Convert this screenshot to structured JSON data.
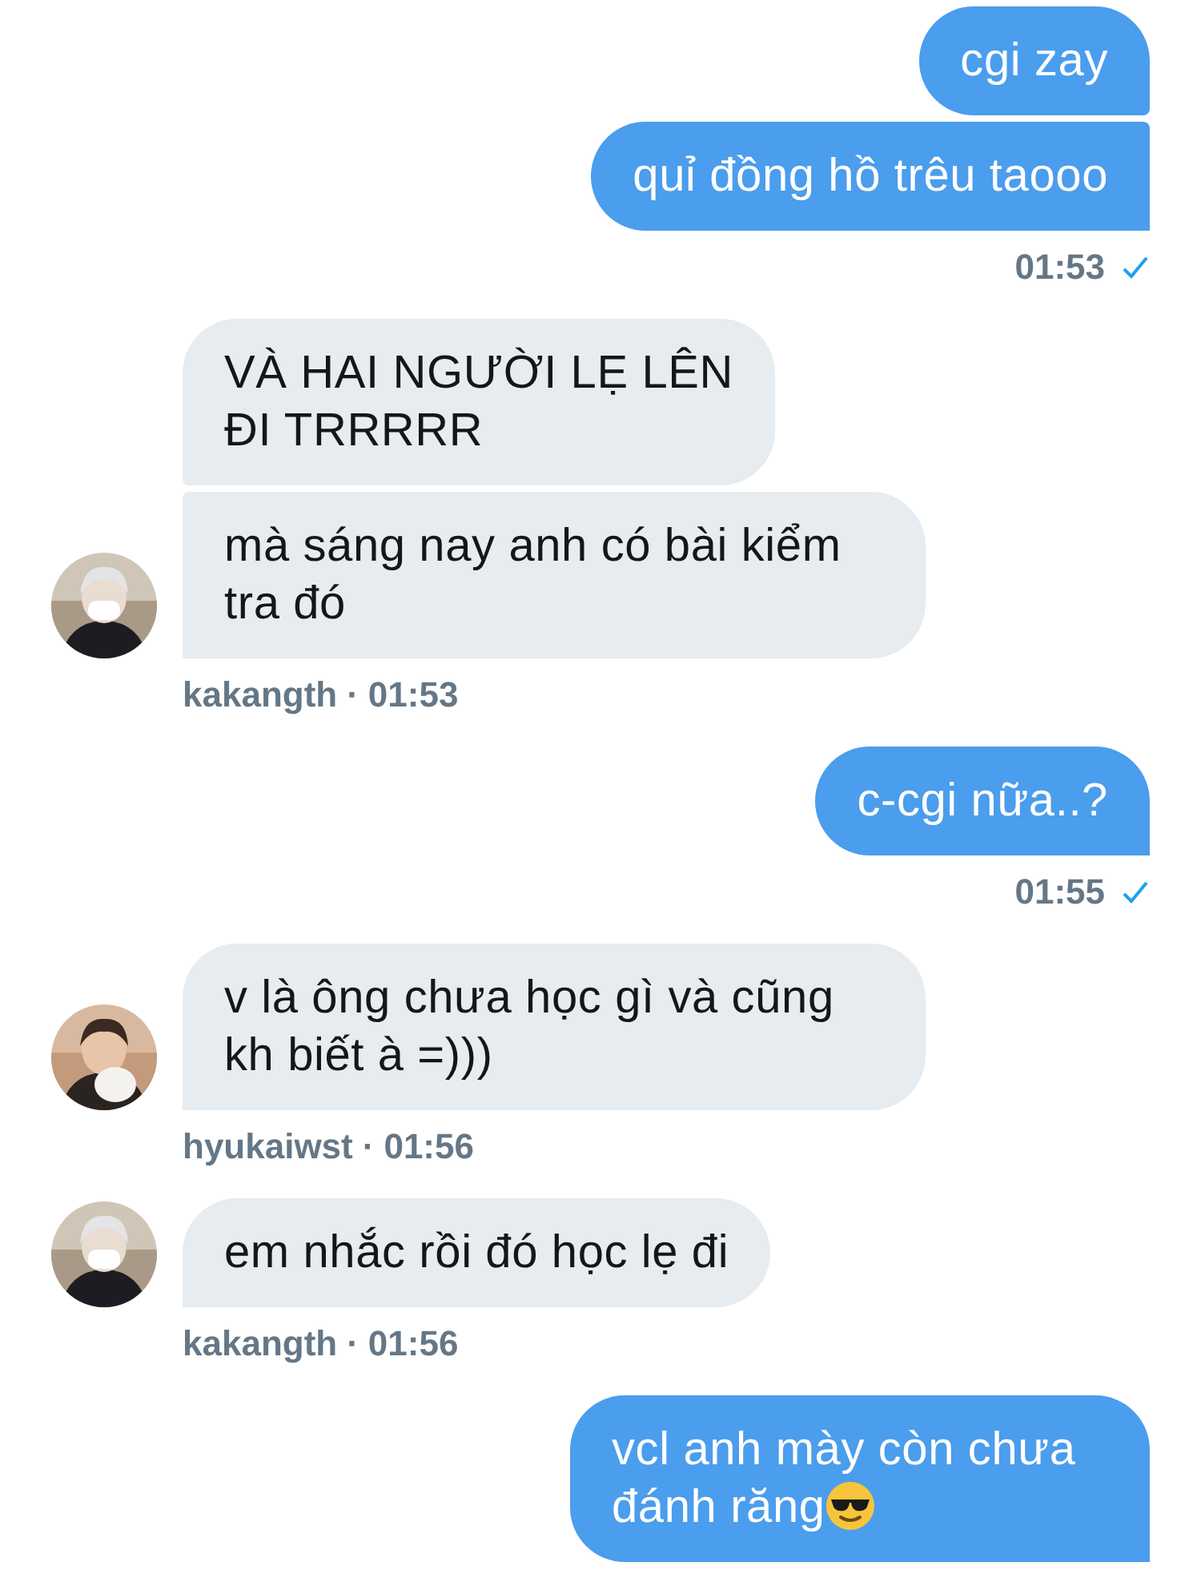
{
  "messages_view": {
    "groups": [
      {
        "kind": "outgoing",
        "messages": [
          {
            "text": "cgi zay"
          },
          {
            "text": "quỉ đồng hồ trêu taooo"
          }
        ],
        "time": "01:53",
        "read": true
      },
      {
        "kind": "incoming",
        "avatar": {
          "kind": "picture"
        },
        "messages": [
          {
            "text": "VÀ HAI NGƯỜI LẸ LÊN\nĐI TRRRRR"
          },
          {
            "text": "mà sáng nay anh có bài kiểm tra đó"
          }
        ],
        "sender": "kakangth",
        "separator": "·",
        "time": "01:53"
      },
      {
        "kind": "outgoing",
        "messages": [
          {
            "text": "c-cgi nữa..?"
          }
        ],
        "time": "01:55",
        "read": true
      },
      {
        "kind": "incoming",
        "avatar": {
          "kind": "picture"
        },
        "messages": [
          {
            "text": "v là ông chưa học gì và cũng kh biết à =)))"
          }
        ],
        "sender": "hyukaiwst",
        "separator": "·",
        "time": "01:56"
      },
      {
        "kind": "incoming",
        "avatar": {
          "kind": "picture"
        },
        "messages": [
          {
            "text": "em nhắc rồi đó học lẹ đi"
          }
        ],
        "sender": "kakangth",
        "separator": "·",
        "time": "01:56"
      },
      {
        "kind": "outgoing",
        "messages": [
          {
            "kind": "text_with_sunglasses_emoji",
            "text": "vcl anh mày còn chưa đánh răng"
          }
        ]
      }
    ]
  }
}
